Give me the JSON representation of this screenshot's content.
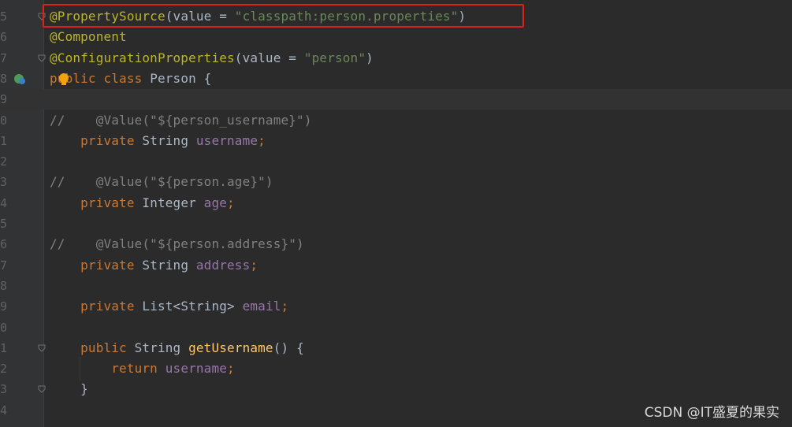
{
  "editor": {
    "lines": [
      {
        "no": "5",
        "tokens": [
          [
            "ann",
            "@PropertySource"
          ],
          [
            "plain",
            "(value = "
          ],
          [
            "str",
            "\"classpath:person.properties\""
          ],
          [
            "plain",
            ")"
          ]
        ]
      },
      {
        "no": "6",
        "tokens": [
          [
            "ann",
            "@Component"
          ]
        ]
      },
      {
        "no": "7",
        "tokens": [
          [
            "ann",
            "@ConfigurationProperties"
          ],
          [
            "plain",
            "(value = "
          ],
          [
            "str",
            "\"person\""
          ],
          [
            "plain",
            ")"
          ]
        ]
      },
      {
        "no": "8",
        "tokens": [
          [
            "kw",
            "public class "
          ],
          [
            "plain",
            "Person {"
          ]
        ]
      },
      {
        "no": "9",
        "tokens": []
      },
      {
        "no": "0",
        "tokens": [
          [
            "cmt",
            "//    @Value(\"${person_username}\")"
          ]
        ]
      },
      {
        "no": "1",
        "tokens": [
          [
            "plain",
            "    "
          ],
          [
            "kw",
            "private "
          ],
          [
            "plain",
            "String "
          ],
          [
            "fld",
            "username"
          ],
          [
            "kw",
            ";"
          ]
        ]
      },
      {
        "no": "2",
        "tokens": []
      },
      {
        "no": "3",
        "tokens": [
          [
            "cmt",
            "//    @Value(\"${person.age}\")"
          ]
        ]
      },
      {
        "no": "4",
        "tokens": [
          [
            "plain",
            "    "
          ],
          [
            "kw",
            "private "
          ],
          [
            "plain",
            "Integer "
          ],
          [
            "fld",
            "age"
          ],
          [
            "kw",
            ";"
          ]
        ]
      },
      {
        "no": "5",
        "tokens": []
      },
      {
        "no": "6",
        "tokens": [
          [
            "cmt",
            "//    @Value(\"${person.address}\")"
          ]
        ]
      },
      {
        "no": "7",
        "tokens": [
          [
            "plain",
            "    "
          ],
          [
            "kw",
            "private "
          ],
          [
            "plain",
            "String "
          ],
          [
            "fld",
            "address"
          ],
          [
            "kw",
            ";"
          ]
        ]
      },
      {
        "no": "8",
        "tokens": []
      },
      {
        "no": "9",
        "tokens": [
          [
            "plain",
            "    "
          ],
          [
            "kw",
            "private "
          ],
          [
            "plain",
            "List<String> "
          ],
          [
            "fld",
            "email"
          ],
          [
            "kw",
            ";"
          ]
        ]
      },
      {
        "no": "0",
        "tokens": []
      },
      {
        "no": "1",
        "tokens": [
          [
            "plain",
            "    "
          ],
          [
            "kw",
            "public "
          ],
          [
            "plain",
            "String "
          ],
          [
            "fn",
            "getUsername"
          ],
          [
            "plain",
            "() {"
          ]
        ]
      },
      {
        "no": "2",
        "tokens": [
          [
            "plain",
            "        "
          ],
          [
            "kw",
            "return "
          ],
          [
            "fld",
            "username"
          ],
          [
            "kw",
            ";"
          ]
        ]
      },
      {
        "no": "3",
        "tokens": [
          [
            "plain",
            "    }"
          ]
        ]
      },
      {
        "no": "4",
        "tokens": []
      }
    ]
  },
  "icons": {
    "run_gutter": "spring-bean-icon",
    "intention": "lightbulb-icon",
    "fold": "fold-marker-icon"
  },
  "colors": {
    "background": "#2b2b2b",
    "annotation": "#bbb529",
    "keyword": "#cc7832",
    "string": "#6a8759",
    "comment": "#808080",
    "field": "#9876aa",
    "highlight_box": "#e0201b"
  },
  "watermark": "CSDN @IT盛夏的果实"
}
